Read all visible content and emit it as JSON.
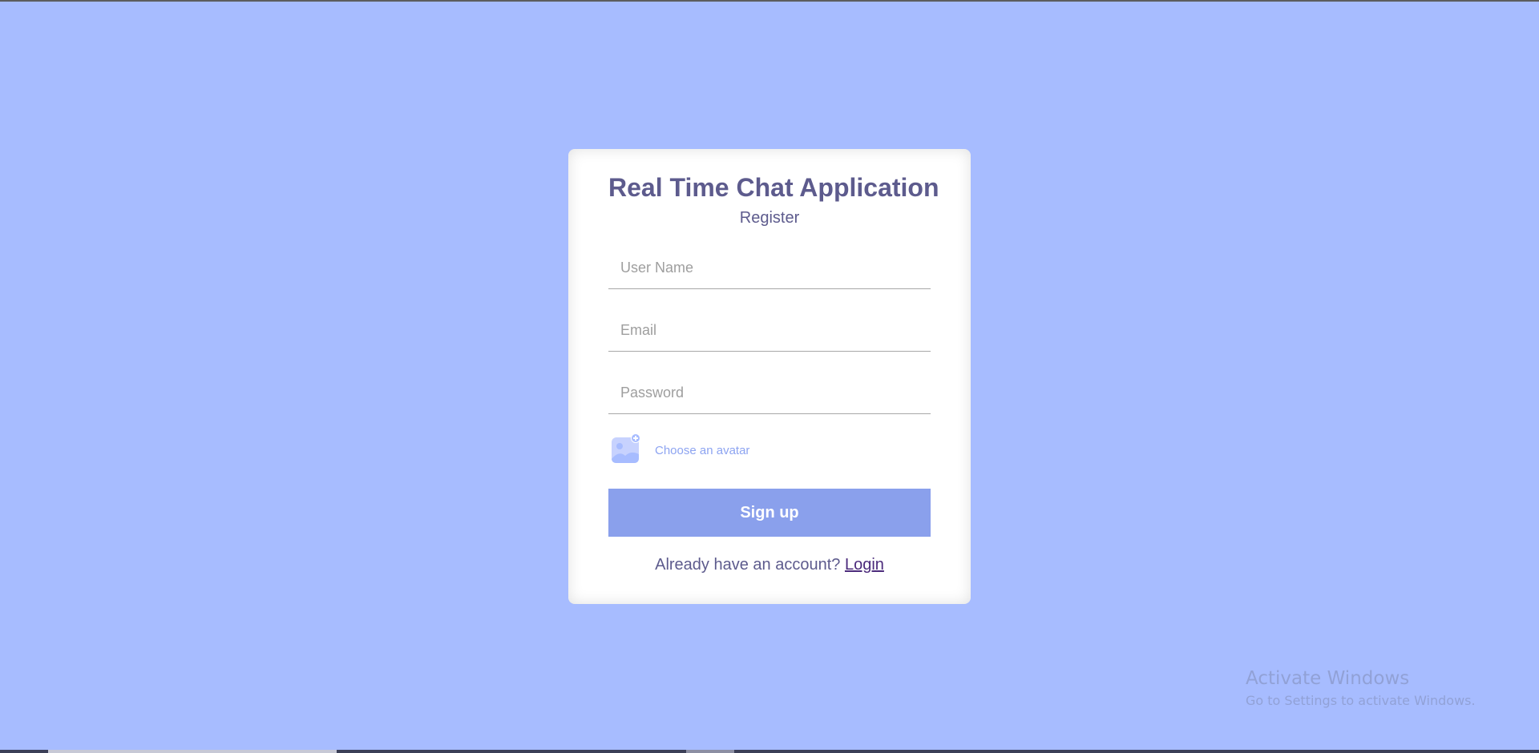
{
  "colors": {
    "page_background": "#a7bcff",
    "card_background": "#ffffff",
    "title_text": "#5d5b8d",
    "button_background": "#8aa0ec",
    "avatar_label": "#8da4f1",
    "link": "#4b2a7b"
  },
  "form": {
    "app_title": "Real Time Chat Application",
    "subtitle": "Register",
    "username_placeholder": "User Name",
    "email_placeholder": "Email",
    "password_placeholder": "Password",
    "avatar_icon": "add-image-icon",
    "avatar_label": "Choose an avatar",
    "signup_label": "Sign up",
    "footer_prompt": "Already have an account?",
    "login_link": "Login"
  },
  "watermark": {
    "title": "Activate Windows",
    "subtitle": "Go to Settings to activate Windows."
  }
}
